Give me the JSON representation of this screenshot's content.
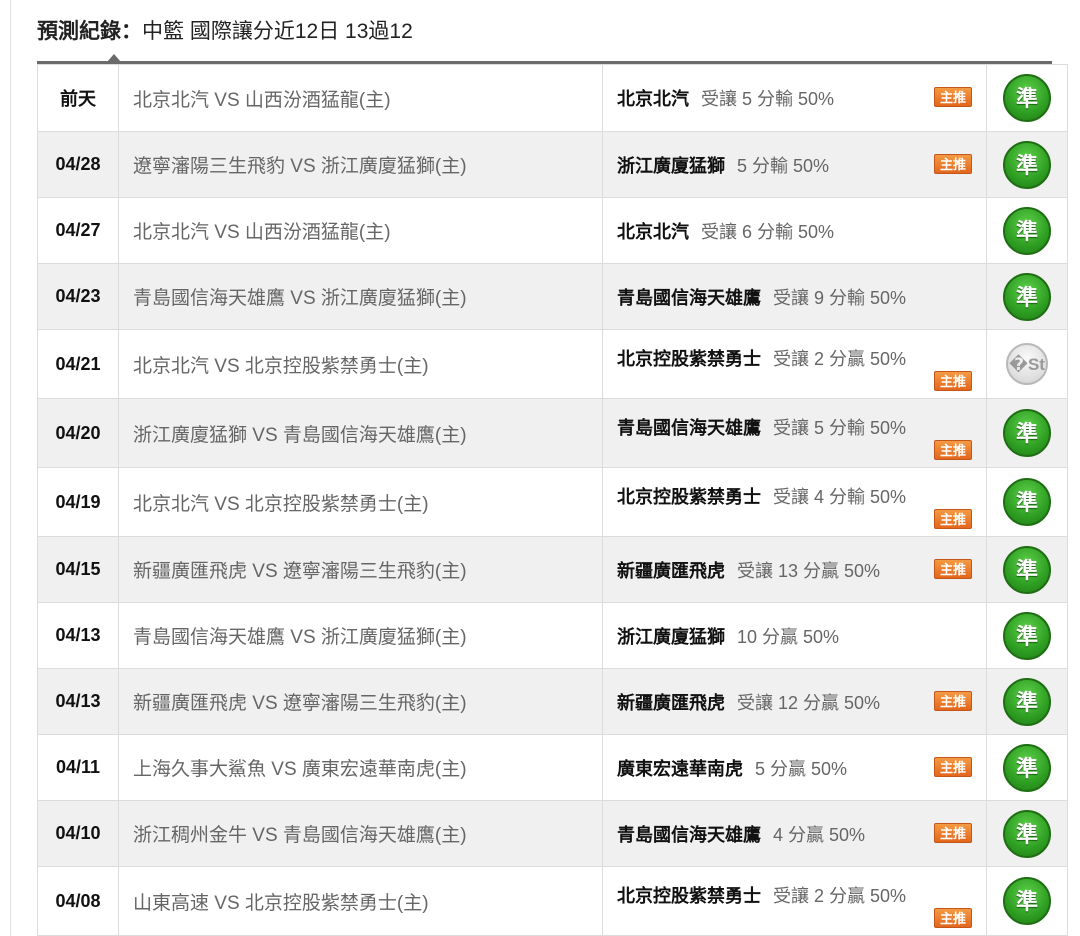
{
  "header": {
    "label": "預測紀錄：",
    "summary": "中籃 國際讓分近12日 13過12"
  },
  "rows": [
    {
      "date": "前天",
      "match": "北京北汽 VS 山西汾酒猛龍(主)",
      "pick_team": "北京北汽",
      "pick_odds": "受讓 5 分輸 50%",
      "recommend": "主推",
      "rec_position": "side",
      "result": "準",
      "result_type": "hit"
    },
    {
      "date": "04/28",
      "match": "遼寧瀋陽三生飛豹 VS 浙江廣廈猛獅(主)",
      "pick_team": "浙江廣廈猛獅",
      "pick_odds": "5 分輸 50%",
      "recommend": "主推",
      "rec_position": "side",
      "result": "準",
      "result_type": "hit"
    },
    {
      "date": "04/27",
      "match": "北京北汽 VS 山西汾酒猛龍(主)",
      "pick_team": "北京北汽",
      "pick_odds": "受讓 6 分輸 50%",
      "recommend": "",
      "rec_position": "none",
      "result": "準",
      "result_type": "hit"
    },
    {
      "date": "04/23",
      "match": "青島國信海天雄鷹 VS 浙江廣廈猛獅(主)",
      "pick_team": "青島國信海天雄鷹",
      "pick_odds": "受讓 9 分輸 50%",
      "recommend": "",
      "rec_position": "none",
      "result": "準",
      "result_type": "hit"
    },
    {
      "date": "04/21",
      "match": "北京北汽 VS 北京控股紫禁勇士(主)",
      "pick_team": "北京控股紫禁勇士",
      "pick_odds": "受讓 2 分贏 50%",
      "recommend": "主推",
      "rec_position": "below",
      "result": "�St",
      "result_type": "push"
    },
    {
      "date": "04/20",
      "match": "浙江廣廈猛獅 VS 青島國信海天雄鷹(主)",
      "pick_team": "青島國信海天雄鷹",
      "pick_odds": "受讓 5 分輸 50%",
      "recommend": "主推",
      "rec_position": "below",
      "result": "準",
      "result_type": "hit"
    },
    {
      "date": "04/19",
      "match": "北京北汽 VS 北京控股紫禁勇士(主)",
      "pick_team": "北京控股紫禁勇士",
      "pick_odds": "受讓 4 分輸 50%",
      "recommend": "主推",
      "rec_position": "below",
      "result": "準",
      "result_type": "hit"
    },
    {
      "date": "04/15",
      "match": "新疆廣匯飛虎 VS 遼寧瀋陽三生飛豹(主)",
      "pick_team": "新疆廣匯飛虎",
      "pick_odds": "受讓 13 分贏 50%",
      "recommend": "主推",
      "rec_position": "side",
      "result": "準",
      "result_type": "hit"
    },
    {
      "date": "04/13",
      "match": "青島國信海天雄鷹 VS 浙江廣廈猛獅(主)",
      "pick_team": "浙江廣廈猛獅",
      "pick_odds": "10 分贏 50%",
      "recommend": "",
      "rec_position": "none",
      "result": "準",
      "result_type": "hit"
    },
    {
      "date": "04/13",
      "match": "新疆廣匯飛虎 VS 遼寧瀋陽三生飛豹(主)",
      "pick_team": "新疆廣匯飛虎",
      "pick_odds": "受讓 12 分贏 50%",
      "recommend": "主推",
      "rec_position": "side",
      "result": "準",
      "result_type": "hit"
    },
    {
      "date": "04/11",
      "match": "上海久事大鯊魚 VS 廣東宏遠華南虎(主)",
      "pick_team": "廣東宏遠華南虎",
      "pick_odds": "5 分贏 50%",
      "recommend": "主推",
      "rec_position": "side",
      "result": "準",
      "result_type": "hit"
    },
    {
      "date": "04/10",
      "match": "浙江稠州金牛 VS 青島國信海天雄鷹(主)",
      "pick_team": "青島國信海天雄鷹",
      "pick_odds": "4 分贏 50%",
      "recommend": "主推",
      "rec_position": "side",
      "result": "準",
      "result_type": "hit"
    },
    {
      "date": "04/08",
      "match": "山東高速 VS 北京控股紫禁勇士(主)",
      "pick_team": "北京控股紫禁勇士",
      "pick_odds": "受讓 2 分贏 50%",
      "recommend": "主推",
      "rec_position": "below",
      "result": "準",
      "result_type": "hit"
    }
  ],
  "colors": {
    "hit": "#2e9e22",
    "push": "#c6c6c6",
    "recommend": "#e3661c",
    "row_alt": "#f0f0f0"
  }
}
